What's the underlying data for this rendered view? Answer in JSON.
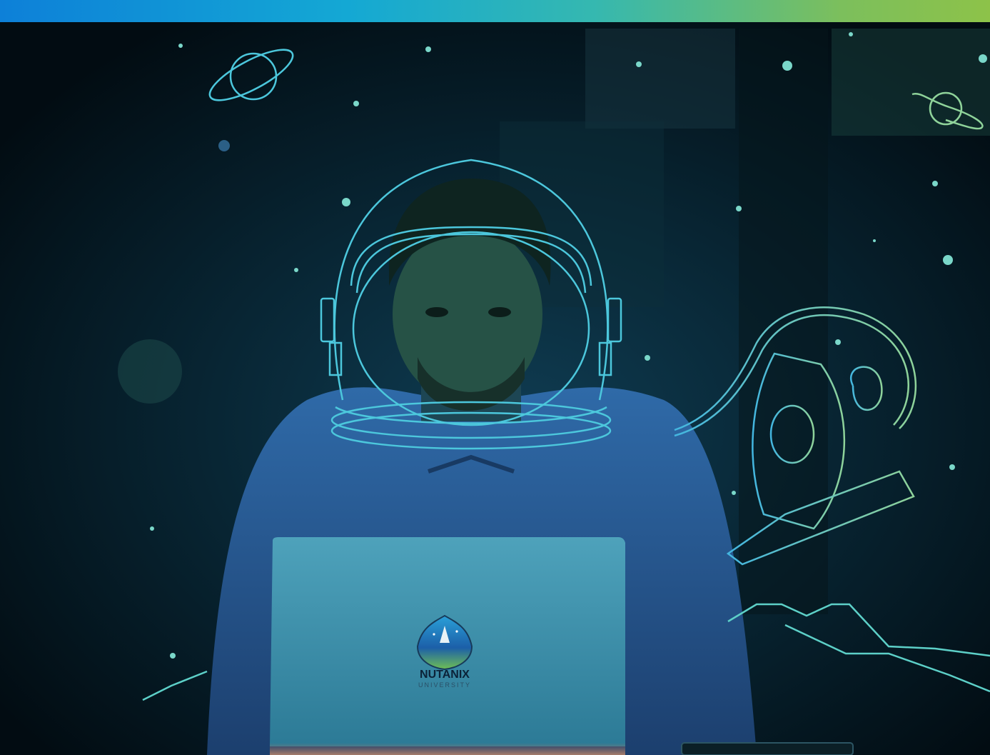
{
  "logo": {
    "brand": "NUTANIX",
    "sub": "UNIVERSITY"
  },
  "colors": {
    "gradient_start": "#0d80d8",
    "gradient_end": "#8dc249",
    "line_art_teal": "#5fd3d6",
    "line_art_green": "#8fd39a"
  },
  "icons": [
    "saturn-doodle",
    "astronaut-helmet-doodle",
    "rocket-doodle",
    "planet-doodle",
    "mountains-doodle"
  ]
}
